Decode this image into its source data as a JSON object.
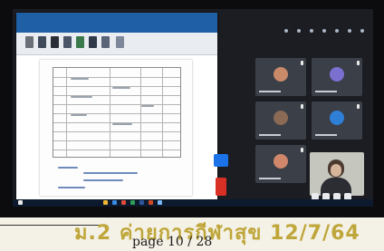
{
  "caption": {
    "text": "ม.2 ค่ายการกีฬาสุข 12/7/64"
  },
  "page_indicator": {
    "text": "page 10 / 28"
  },
  "colors": {
    "ribbon": "#1f5fa6",
    "caption_gold": "#bfa63a",
    "end_call": "#d93025",
    "accent_blue": "#1a73e8"
  },
  "participants": [
    {
      "avatar_color": "#c98a6a"
    },
    {
      "avatar_color": "#7b6fd0"
    },
    {
      "avatar_color": "#8a6a55"
    },
    {
      "avatar_color": "#2f7fd6"
    },
    {
      "avatar_color": "#d0876a"
    }
  ]
}
